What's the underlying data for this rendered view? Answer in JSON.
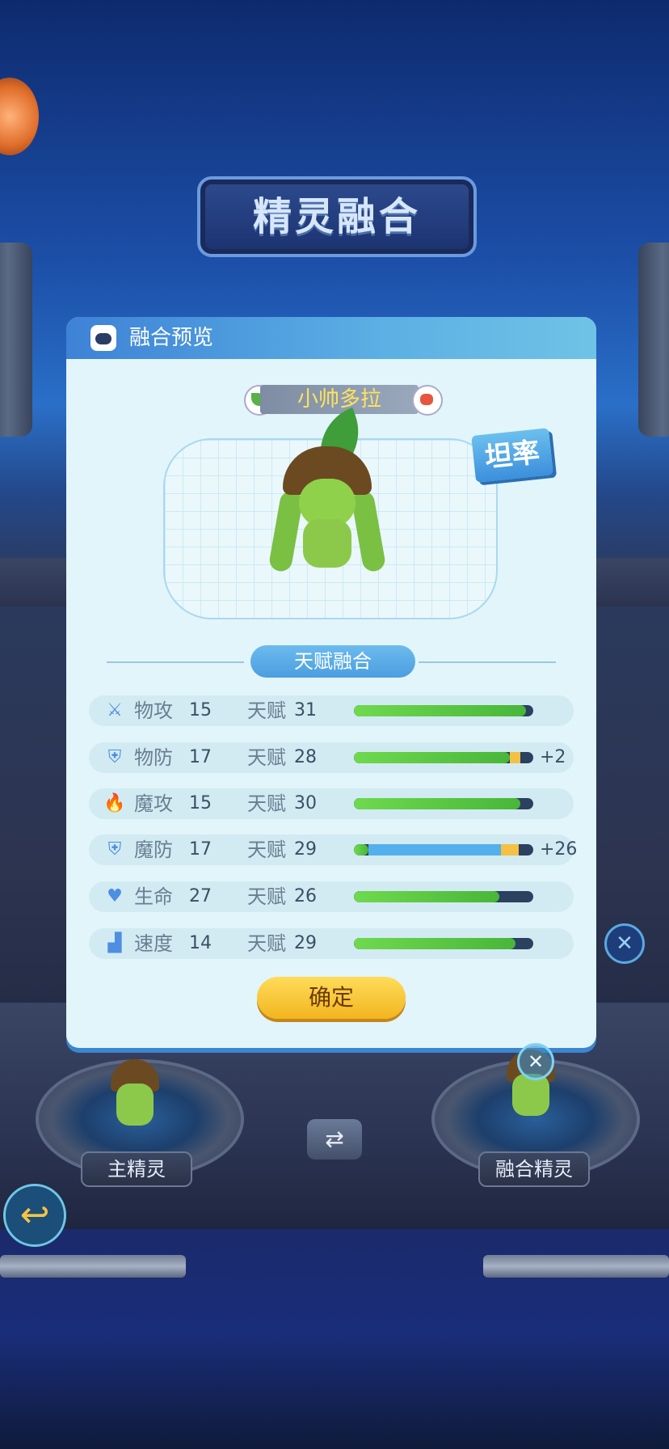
{
  "title": "精灵融合",
  "preview_panel": {
    "header": "融合预览",
    "pet_name": "小帅多拉",
    "trait": "坦率",
    "section_label": "天赋融合",
    "talent_label": "天赋",
    "stats": [
      {
        "icon": "sword-icon",
        "name": "物攻",
        "value": "15",
        "talent": "31",
        "bar_fill": 0.96,
        "bonus": ""
      },
      {
        "icon": "shield-icon",
        "name": "物防",
        "value": "17",
        "talent": "28",
        "bar_fill": 0.87,
        "orange": 0.06,
        "bonus": "+2"
      },
      {
        "icon": "flame-icon",
        "name": "魔攻",
        "value": "15",
        "talent": "30",
        "bar_fill": 0.93,
        "bonus": ""
      },
      {
        "icon": "magic-shield-icon",
        "name": "魔防",
        "value": "17",
        "talent": "29",
        "bar_fill": 0.08,
        "blue": 0.74,
        "orange": 0.1,
        "bonus": "+26"
      },
      {
        "icon": "heart-icon",
        "name": "生命",
        "value": "27",
        "talent": "26",
        "bar_fill": 0.81,
        "bonus": ""
      },
      {
        "icon": "boot-icon",
        "name": "速度",
        "value": "14",
        "talent": "29",
        "bar_fill": 0.9,
        "bonus": ""
      }
    ],
    "confirm_label": "确定"
  },
  "slots": {
    "main_label": "主精灵",
    "fusion_label": "融合精灵"
  },
  "colors": {
    "accent": "#4b9ee0",
    "confirm": "#f2b51f",
    "name_text": "#ffe35c"
  }
}
